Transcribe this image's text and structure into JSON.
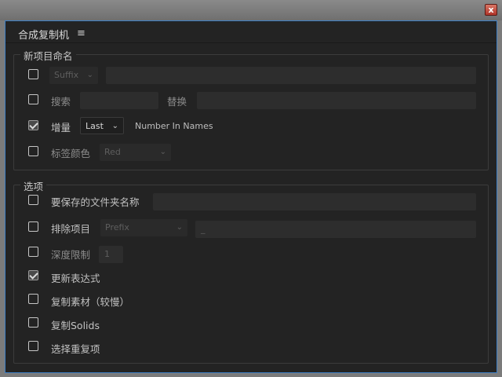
{
  "titlebar": {
    "close_glyph": "x"
  },
  "panel": {
    "title": "合成复制机",
    "menu_glyph": "≡"
  },
  "naming": {
    "legend": "新项目命名",
    "suffix_select": "Suffix",
    "search_label": "搜索",
    "replace_label": "替换",
    "increment_label": "增量",
    "increment_select": "Last",
    "increment_hint": "Number In Names",
    "label_color_label": "标签颜色",
    "label_color_select": "Red"
  },
  "options": {
    "legend": "选项",
    "folder_name_label": "要保存的文件夹名称",
    "exclude_label": "排除项目",
    "exclude_select": "Prefix",
    "exclude_value": "_",
    "depth_label": "深度限制",
    "depth_value": "1",
    "update_expr_label": "更新表达式",
    "copy_footage_label": "复制素材（较慢）",
    "copy_solids_label": "复制Solids",
    "select_dupes_label": "选择重复项"
  },
  "checkbox_states": {
    "suffix": false,
    "search": false,
    "increment": true,
    "label_color": false,
    "folder_name": false,
    "exclude": false,
    "depth": false,
    "update_expr": true,
    "copy_footage": false,
    "copy_solids": false,
    "select_dupes": false
  },
  "icons": {
    "close": "close-icon",
    "menu": "hamburger-menu-icon",
    "dropdown": "chevron-down-icon"
  },
  "colors": {
    "panel_bg": "#232323",
    "window_border": "#3d7fc4",
    "close_red": "#c0392b"
  }
}
